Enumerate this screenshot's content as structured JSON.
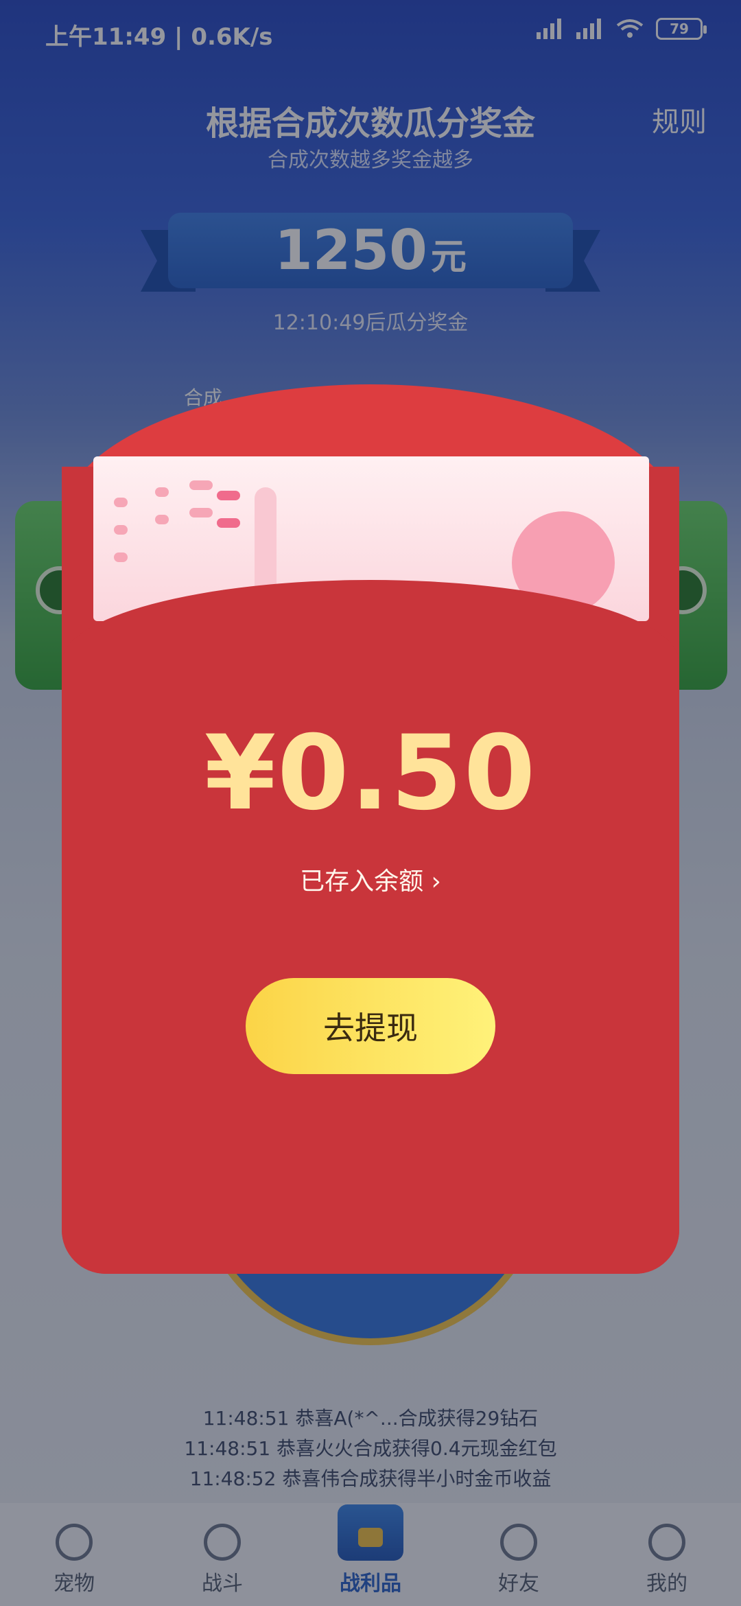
{
  "status_bar": {
    "time_speed": "上午11:49 | 0.6K/s",
    "battery": "79"
  },
  "header": {
    "title": "根据合成次数瓜分奖金",
    "subtitle": "合成次数越多奖金越多",
    "rules_label": "规则"
  },
  "prize": {
    "amount": "1250",
    "unit": "元",
    "countdown": "12:10:49后瓜分奖金"
  },
  "merge_label": "合成",
  "ticker": [
    "11:48:51 恭喜A(*^...合成获得29钻石",
    "11:48:51 恭喜火火合成获得0.4元现金红包",
    "11:48:52 恭喜伟合成获得半小时金币收益"
  ],
  "tabs": [
    {
      "label": "宠物"
    },
    {
      "label": "战斗"
    },
    {
      "label": "战利品"
    },
    {
      "label": "好友"
    },
    {
      "label": "我的"
    }
  ],
  "modal": {
    "amount": "¥0.50",
    "saved_text": "已存入余额 ›",
    "withdraw_label": "去提现"
  },
  "colors": {
    "envelope_red": "#c9353b",
    "amount_gold": "#ffe39a",
    "button_yellow": "#fbd447"
  }
}
